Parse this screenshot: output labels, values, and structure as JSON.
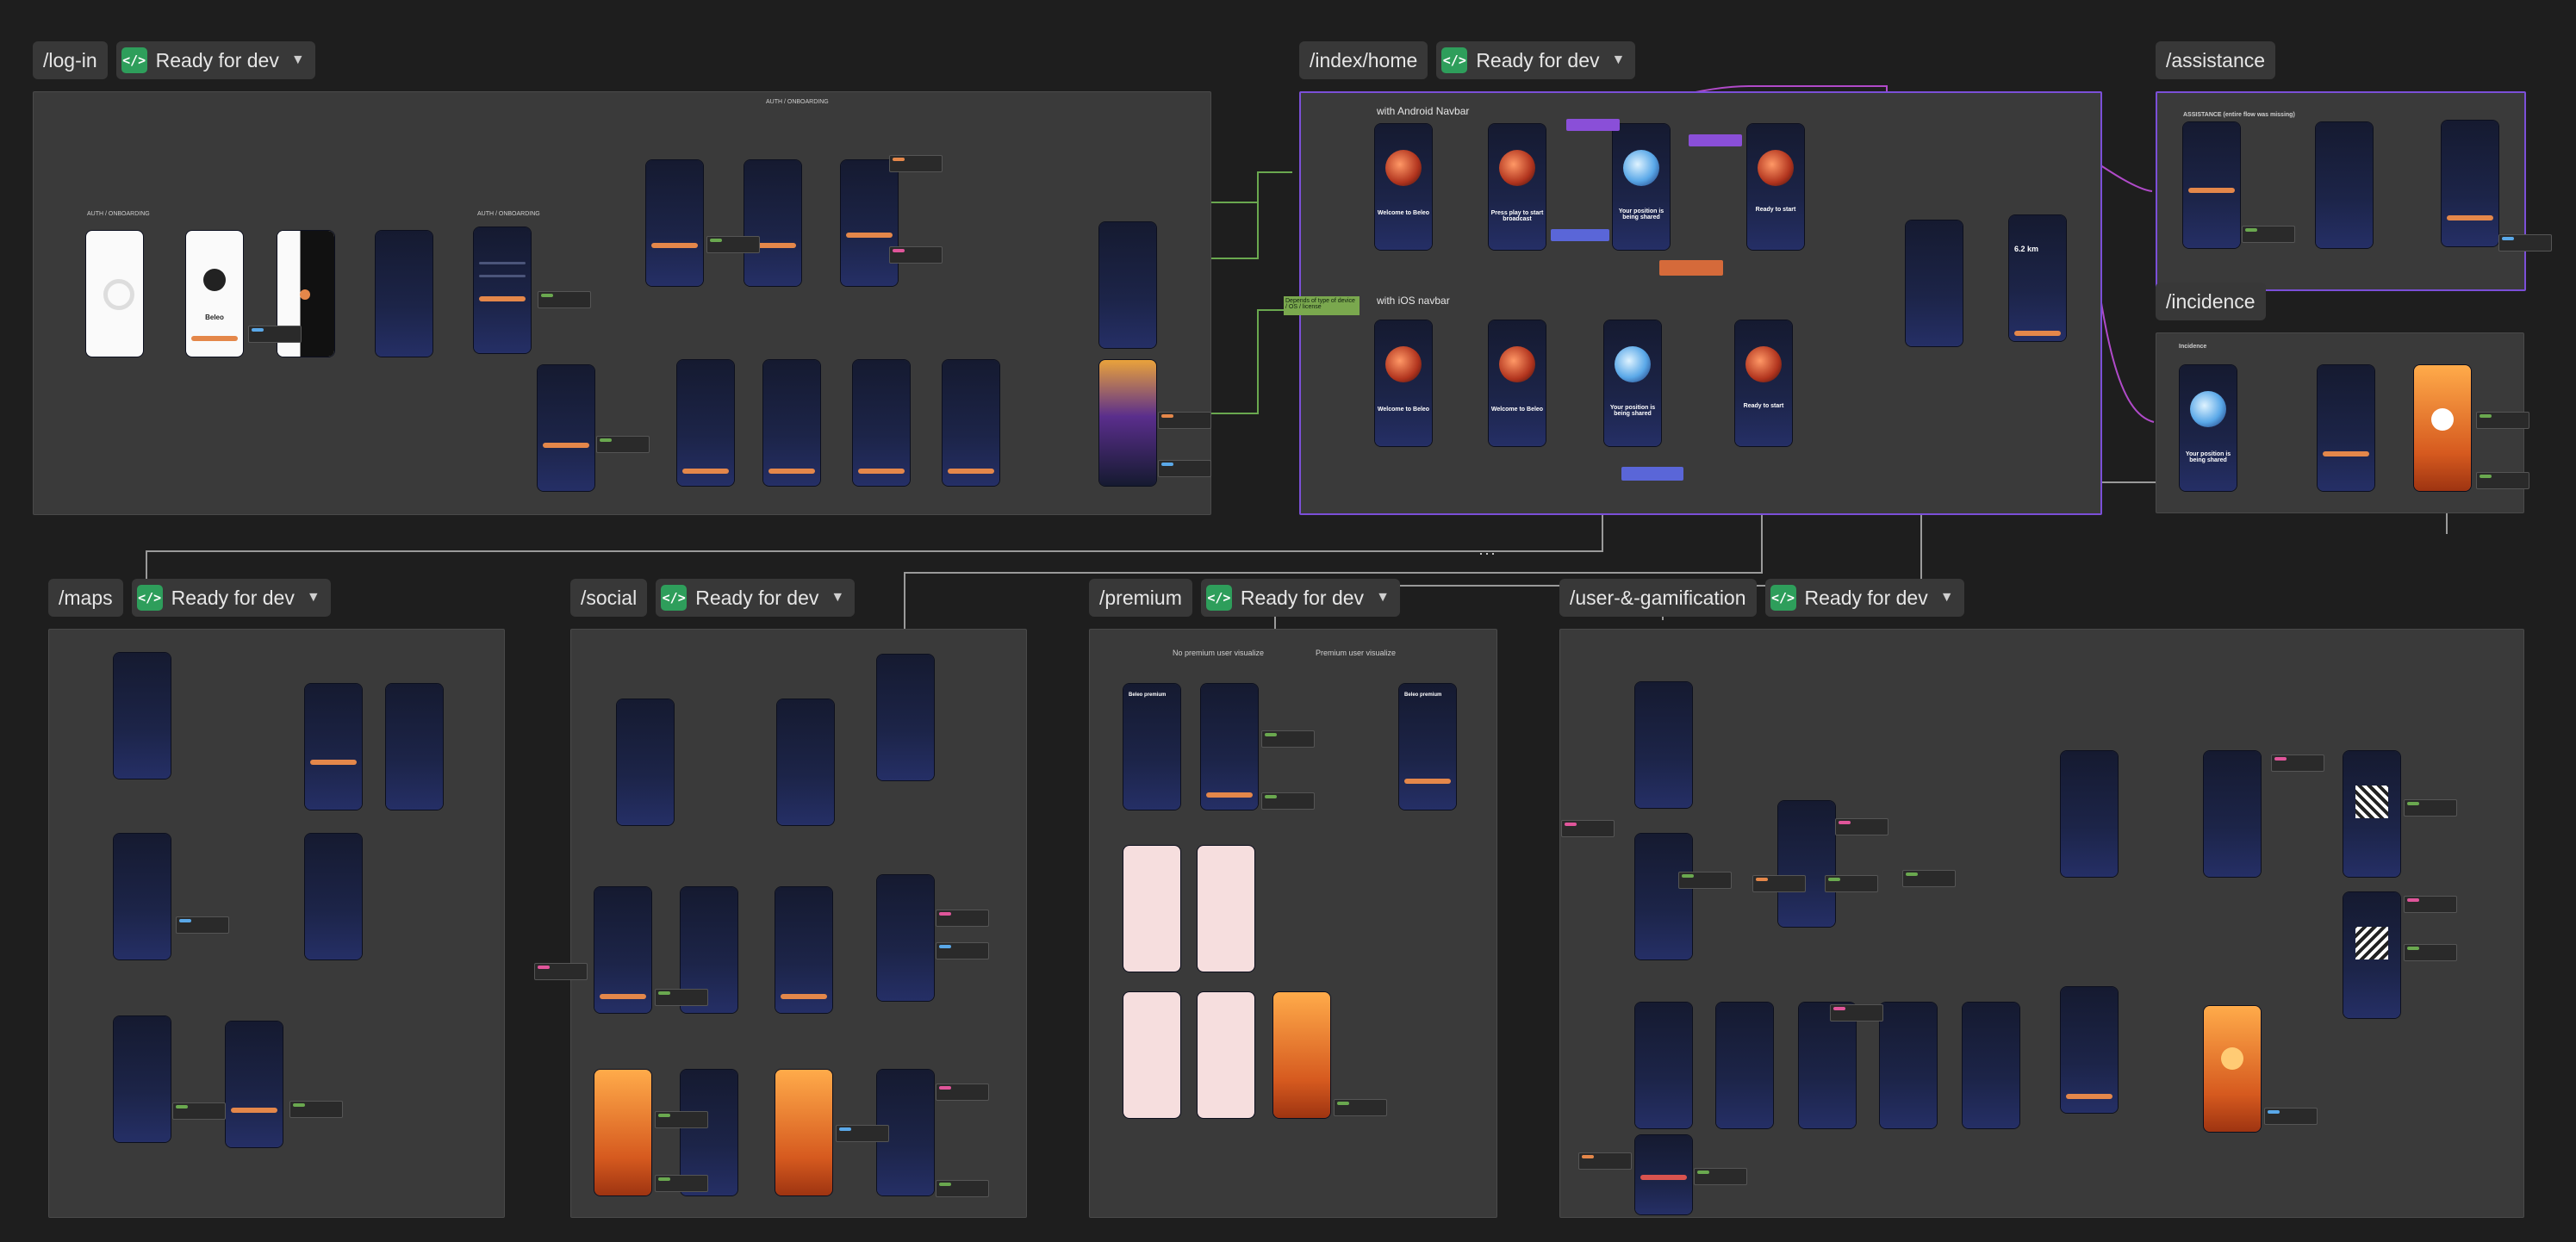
{
  "colors": {
    "canvas": "#1e1e1e",
    "section": "#3a3a3a",
    "ready_green": "#2e9e5b",
    "selection_purple": "#7b4fd8",
    "accent_orange": "#e4874a"
  },
  "sections": {
    "login": {
      "path": "/log-in",
      "status": "Ready for dev",
      "frame_title": "AUTH / ONBOARDING",
      "left_label": "AUTH / ONBOARDING",
      "mid_label": "AUTH / ONBOARDING",
      "splash_brand": "Beleo"
    },
    "home": {
      "path": "/index/home",
      "status": "Ready for dev",
      "android_label": "with Android Navbar",
      "ios_label": "with iOS navbar",
      "note_label": "Depends of type of device / OS / license",
      "screens": [
        "Welcome to Beleo",
        "Press play to start broadcast",
        "Your position is being shared",
        "Ready to start",
        "Your position is being shared",
        "Ready to start"
      ],
      "distance": "6.2 km"
    },
    "assistance": {
      "path": "/assistance",
      "frame_title": "ASSISTANCE (entire flow was missing)"
    },
    "incidence": {
      "path": "/incidence",
      "frame_title": "Incidence",
      "screen_caption": "Your position is being shared"
    },
    "maps": {
      "path": "/maps",
      "status": "Ready for dev"
    },
    "social": {
      "path": "/social",
      "status": "Ready for dev"
    },
    "premium": {
      "path": "/premium",
      "status": "Ready for dev",
      "branch_left": "No premium user visualize",
      "branch_right": "Premium user visualize",
      "screen_title": "Beleo premium"
    },
    "user_gamification": {
      "path": "/user-&-gamification",
      "status": "Ready for dev"
    }
  },
  "icons": {
    "status": "code-icon",
    "dropdown": "chevron-down-icon",
    "more": "more-dots-icon"
  }
}
